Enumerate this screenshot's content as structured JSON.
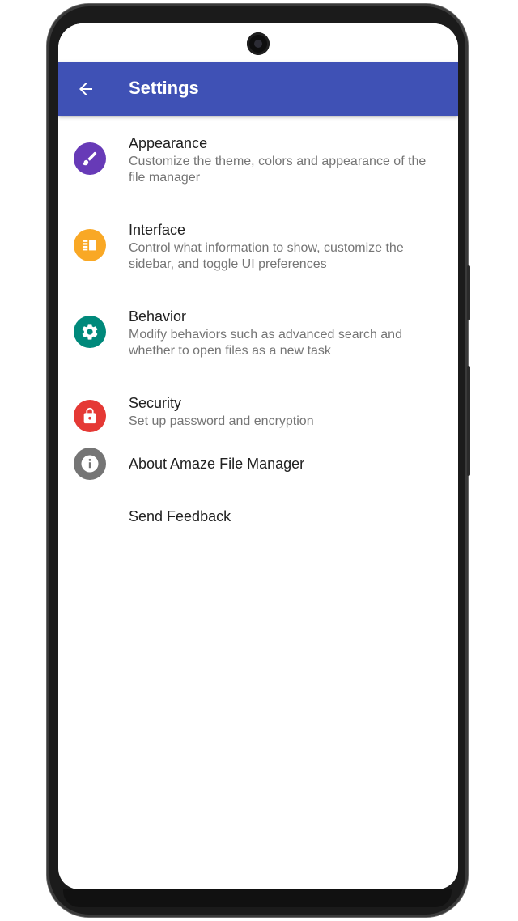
{
  "toolbar": {
    "title": "Settings",
    "back_icon": "arrow-back-icon"
  },
  "colors": {
    "toolbar": "#3f51b5",
    "appearance": "#673ab7",
    "interface": "#f9a825",
    "behavior": "#00897b",
    "security": "#e53935",
    "about": "#757575"
  },
  "settings": [
    {
      "title": "Appearance",
      "summary": "Customize the theme, colors and appearance of the file manager",
      "icon": "brush-icon"
    },
    {
      "title": "Interface",
      "summary": "Control what information to show, customize the sidebar, and toggle UI preferences",
      "icon": "view-quilt-icon"
    },
    {
      "title": "Behavior",
      "summary": "Modify behaviors such as advanced search and whether to open files as a new task",
      "icon": "gear-icon"
    },
    {
      "title": "Security",
      "summary": "Set up password and encryption",
      "icon": "lock-icon"
    },
    {
      "title": "About Amaze File Manager",
      "icon": "info-icon"
    },
    {
      "title": "Send Feedback"
    }
  ]
}
